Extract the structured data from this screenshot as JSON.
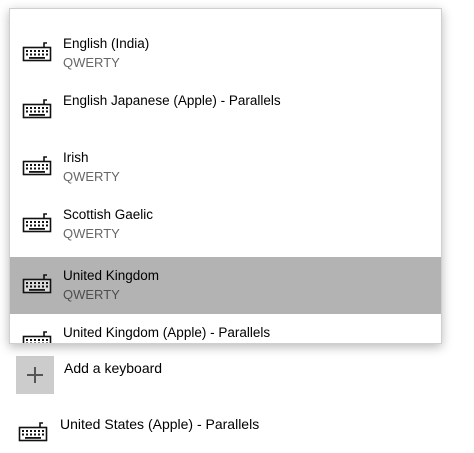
{
  "keyboard_list": {
    "items": [
      {
        "name": "English (India)",
        "layout": "QWERTY",
        "selected": false
      },
      {
        "name": "English Japanese (Apple) - Parallels",
        "layout": "",
        "selected": false
      },
      {
        "name": "Irish",
        "layout": "QWERTY",
        "selected": false
      },
      {
        "name": "Scottish Gaelic",
        "layout": "QWERTY",
        "selected": false
      },
      {
        "name": "United Kingdom",
        "layout": "QWERTY",
        "selected": true
      },
      {
        "name": "United Kingdom (Apple) - Parallels",
        "layout": "",
        "selected": false
      }
    ]
  },
  "add_keyboard": {
    "label": "Add a keyboard",
    "icon": "plus-icon"
  },
  "installed_keyboard": {
    "name": "United States (Apple) - Parallels",
    "icon": "keyboard-icon"
  },
  "colors": {
    "selected_bg": "#b3b3b3",
    "tile_bg": "#cccccc",
    "secondary_text": "#666666"
  }
}
